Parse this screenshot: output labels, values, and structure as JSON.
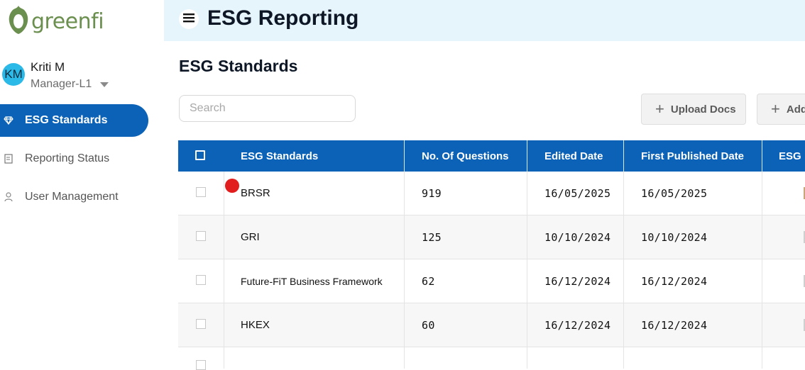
{
  "brand": {
    "name": "greenfi"
  },
  "user": {
    "initials": "KM",
    "name": "Kriti M",
    "role": "Manager-L1"
  },
  "sidebar": {
    "items": [
      {
        "label": "ESG Standards",
        "icon": "diamond-icon",
        "active": true
      },
      {
        "label": "Reporting Status",
        "icon": "report-icon",
        "active": false
      },
      {
        "label": "User Management",
        "icon": "user-icon",
        "active": false
      }
    ]
  },
  "header": {
    "title": "ESG Reporting"
  },
  "main": {
    "section_title": "ESG Standards",
    "search_placeholder": "Search",
    "buttons": {
      "upload": "Upload Docs",
      "add": "Add"
    }
  },
  "table": {
    "headers": [
      "ESG Standards",
      "No. Of Questions",
      "Edited Date",
      "First Published Date",
      "ESG"
    ],
    "rows": [
      {
        "standard": "BRSR",
        "questions": "919",
        "edited": "16/05/2025",
        "published": "16/05/2025"
      },
      {
        "standard": "GRI",
        "questions": "125",
        "edited": "10/10/2024",
        "published": "10/10/2024"
      },
      {
        "standard": "Future-FiT Business Framework",
        "questions": "62",
        "edited": "16/12/2024",
        "published": "16/12/2024"
      },
      {
        "standard": "HKEX",
        "questions": "60",
        "edited": "16/12/2024",
        "published": "16/12/2024"
      }
    ]
  },
  "colors": {
    "primary": "#0b62b7",
    "header_bg": "#e6f4fc",
    "brand_green": "#6b8f4e",
    "avatar": "#2bb9e8"
  }
}
